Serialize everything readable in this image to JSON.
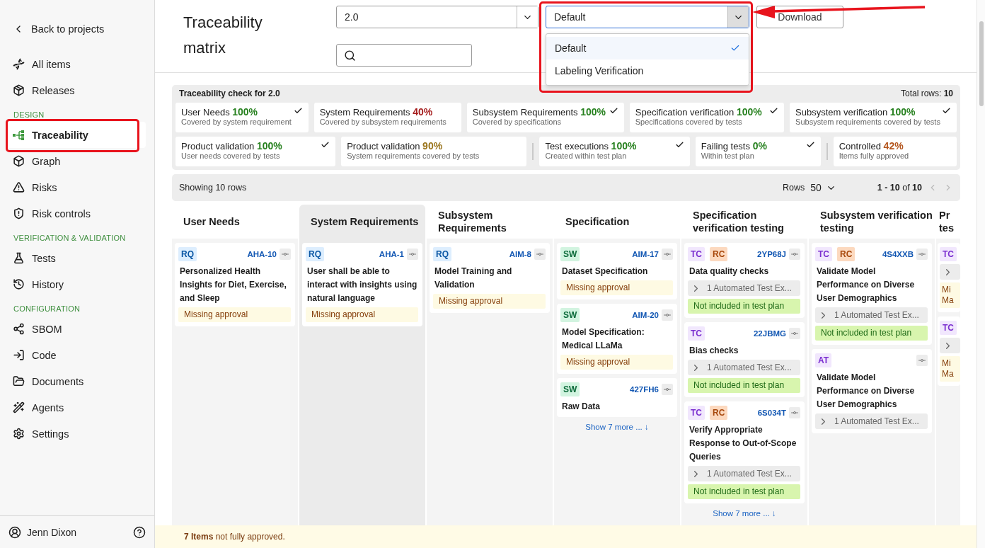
{
  "sidebar": {
    "back": "Back to projects",
    "sections": [
      {
        "items": [
          {
            "label": "All items",
            "selected": false,
            "annotated": false
          },
          {
            "label": "Releases",
            "selected": false,
            "annotated": false
          }
        ]
      },
      {
        "heading": "DESIGN",
        "items": [
          {
            "label": "Traceability",
            "selected": true,
            "annotated": true
          },
          {
            "label": "Graph",
            "selected": false,
            "annotated": false
          },
          {
            "label": "Risks",
            "selected": false,
            "annotated": false
          },
          {
            "label": "Risk controls",
            "selected": false,
            "annotated": false
          }
        ]
      },
      {
        "heading": "VERIFICATION & VALIDATION",
        "items": [
          {
            "label": "Tests",
            "selected": false,
            "annotated": false
          },
          {
            "label": "History",
            "selected": false,
            "annotated": false
          }
        ]
      },
      {
        "heading": "CONFIGURATION",
        "items": [
          {
            "label": "SBOM",
            "selected": false,
            "annotated": false
          },
          {
            "label": "Code",
            "selected": false,
            "annotated": false
          },
          {
            "label": "Documents",
            "selected": false,
            "annotated": false
          },
          {
            "label": "Agents",
            "selected": false,
            "annotated": false
          },
          {
            "label": "Settings",
            "selected": false,
            "annotated": false
          }
        ]
      }
    ],
    "user": "Jenn Dixon"
  },
  "header": {
    "title": "Traceability matrix",
    "release_select": {
      "value": "2.0"
    },
    "view_select": {
      "value": "Default",
      "open": true,
      "annotated": true,
      "options": [
        {
          "label": "Default",
          "selected": true
        },
        {
          "label": "Labeling Verification",
          "selected": false
        }
      ]
    },
    "download": "Download"
  },
  "summary": {
    "title": "Traceability check for 2.0",
    "total": "Total rows: **10**",
    "rows": [
      [
        {
          "label": "User Needs",
          "percent": "100%",
          "color": "#26801e",
          "detail": "Covered by system requirement",
          "checked": true,
          "divider_before": false
        },
        {
          "label": "System Requirements",
          "percent": "40%",
          "color": "#a51c1c",
          "detail": "Covered by subsystem requirements",
          "checked": false,
          "divider_before": false
        },
        {
          "label": "Subsystem Requirements",
          "percent": "100%",
          "color": "#26801e",
          "detail": "Covered by specifications",
          "checked": true,
          "divider_before": false
        },
        {
          "label": "Specification verification",
          "percent": "100%",
          "color": "#26801e",
          "detail": "Specifications covered by tests",
          "checked": true,
          "divider_before": false
        },
        {
          "label": "Subsystem verification",
          "percent": "100%",
          "color": "#26801e",
          "detail": "Subsystem requirements covered by tests",
          "checked": true,
          "divider_before": false
        }
      ],
      [
        {
          "label": "Product validation",
          "percent": "100%",
          "color": "#26801e",
          "detail": "User needs covered by tests",
          "checked": true,
          "divider_before": false
        },
        {
          "label": "Product validation",
          "percent": "90%",
          "color": "#9a741b",
          "detail": "System requirements covered by tests",
          "checked": false,
          "divider_before": false
        },
        {
          "label": "Test executions",
          "percent": "100%",
          "color": "#26801e",
          "detail": "Created within test plan",
          "checked": true,
          "divider_before": true
        },
        {
          "label": "Failing tests",
          "percent": "0%",
          "color": "#26801e",
          "detail": "Within test plan",
          "checked": true,
          "divider_before": false
        },
        {
          "label": "Controlled",
          "percent": "42%",
          "color": "#b4561e",
          "detail": "Items fully approved",
          "checked": false,
          "divider_before": true
        }
      ]
    ]
  },
  "pagination": {
    "showing": "Showing 10 rows",
    "rows_label": "Rows",
    "rows_value": "50",
    "range": "**1 - 10** of **10**"
  },
  "columns": [
    {
      "title": "User Needs",
      "selected": false,
      "cards": [
        {
          "badges": [
            {
              "label": "RQ",
              "kind": "requirement"
            }
          ],
          "title": "Personalized Health Insights for Diet, Exercise, and Sleep",
          "id": "AHA-10",
          "status": {
            "kind": "warning",
            "text": "Missing approval"
          }
        }
      ]
    },
    {
      "title": "System Requirements",
      "selected": true,
      "cards": [
        {
          "badges": [
            {
              "label": "RQ",
              "kind": "requirement"
            }
          ],
          "title": "User shall be able to interact with insights using natural language",
          "id": "AHA-1",
          "status": {
            "kind": "warning",
            "text": "Missing approval"
          }
        }
      ]
    },
    {
      "title": "Subsystem Requirements",
      "selected": false,
      "cards": [
        {
          "badges": [
            {
              "label": "RQ",
              "kind": "requirement"
            }
          ],
          "title": "Model Training and Validation",
          "id": "AIM-8",
          "status": {
            "kind": "warning",
            "text": "Missing approval"
          }
        }
      ]
    },
    {
      "title": "Specification",
      "selected": false,
      "cards": [
        {
          "badges": [
            {
              "label": "SW",
              "kind": "software"
            }
          ],
          "title": "Dataset Specification",
          "id": "AIM-17",
          "status": {
            "kind": "warning",
            "text": "Missing approval"
          }
        },
        {
          "badges": [
            {
              "label": "SW",
              "kind": "software"
            }
          ],
          "title": "Model Specification: Medical LLaMa",
          "id": "AIM-20",
          "status": {
            "kind": "warning",
            "text": "Missing approval"
          }
        },
        {
          "badges": [
            {
              "label": "SW",
              "kind": "software"
            }
          ],
          "title": "Raw Data",
          "id": "427FH6"
        }
      ],
      "more": "Show 7 more ... ↓"
    },
    {
      "title": "Specification verification testing",
      "selected": false,
      "cards": [
        {
          "badges": [
            {
              "label": "TC",
              "kind": "testcase"
            },
            {
              "label": "RC",
              "kind": "riskcontrol"
            }
          ],
          "title": "Data quality checks",
          "id": "2YP68J",
          "expander": {
            "collapsed": true,
            "text": "1 Automated Test Ex..."
          },
          "status": {
            "kind": "ok",
            "text": "Not included in test plan"
          }
        },
        {
          "badges": [
            {
              "label": "TC",
              "kind": "testcase"
            }
          ],
          "title": "Bias checks",
          "id": "22JBMG",
          "expander": {
            "collapsed": true,
            "text": "1 Automated Test Ex..."
          },
          "status": {
            "kind": "ok",
            "text": "Not included in test plan"
          }
        },
        {
          "badges": [
            {
              "label": "TC",
              "kind": "testcase"
            },
            {
              "label": "RC",
              "kind": "riskcontrol"
            }
          ],
          "title": "Verify Appropriate Response to Out-of-Scope Queries",
          "id": "6S034T",
          "expander": {
            "collapsed": true,
            "text": "1 Automated Test Ex..."
          },
          "status": {
            "kind": "ok",
            "text": "Not included in test plan"
          }
        }
      ],
      "more": "Show 7 more ... ↓"
    },
    {
      "title": "Subsystem verification testing",
      "selected": false,
      "cards": [
        {
          "badges": [
            {
              "label": "TC",
              "kind": "testcase"
            },
            {
              "label": "RC",
              "kind": "riskcontrol"
            }
          ],
          "title": "Validate Model Performance on Diverse User Demographics",
          "id": "4S4XXB",
          "expander": {
            "collapsed": true,
            "text": "1 Automated Test Ex..."
          },
          "status": {
            "kind": "ok",
            "text": "Not included in test plan"
          }
        },
        {
          "badges": [
            {
              "label": "AT",
              "kind": "automated"
            }
          ],
          "title": "Validate Model Performance on Diverse User Demographics",
          "expander": {
            "collapsed": true,
            "text": "1 Automated Test Ex..."
          }
        }
      ]
    },
    {
      "title": "Pr tes",
      "selected": false,
      "cards": [
        {
          "badges": [
            {
              "label": "TC",
              "kind": "testcase"
            }
          ],
          "expander": {
            "collapsed": true
          },
          "status": {
            "kind": "warning",
            "text": "Mi Ma"
          }
        },
        {
          "badges": [
            {
              "label": "TC",
              "kind": "testcase"
            }
          ],
          "expander": {
            "collapsed": true
          },
          "status": {
            "kind": "warning",
            "text": "Mi Ma"
          }
        }
      ]
    }
  ],
  "footer": "**7 Items** not fully approved."
}
